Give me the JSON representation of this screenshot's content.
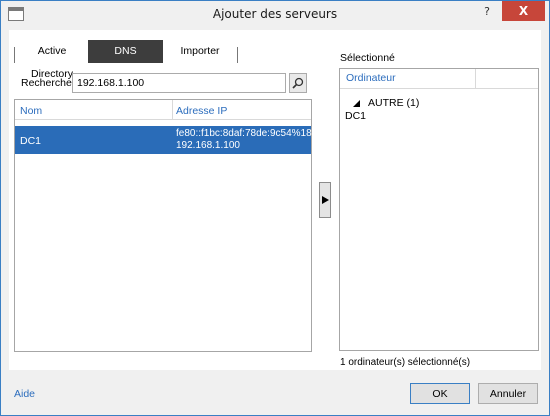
{
  "window": {
    "title": "Ajouter des serveurs",
    "help": "?",
    "close": "X"
  },
  "tabs": [
    {
      "label": "Active Directory",
      "active": false
    },
    {
      "label": "DNS",
      "active": true
    },
    {
      "label": "Importer",
      "active": false
    }
  ],
  "search": {
    "label": "Recherche :",
    "value": "192.168.1.100",
    "button_icon": "search-icon"
  },
  "results": {
    "columns": [
      "Nom",
      "Adresse IP"
    ],
    "rows": [
      {
        "name": "DC1",
        "ip_lines": [
          "fe80::f1bc:8daf:78de:9c54%18",
          "192.168.1.100"
        ],
        "selected": true
      }
    ]
  },
  "move_button": {
    "icon": "arrow-right-icon"
  },
  "selection": {
    "label": "Sélectionné",
    "column": "Ordinateur",
    "group": "AUTRE (1)",
    "items": [
      "DC1"
    ],
    "count_text": "1 ordinateur(s) sélectionné(s)"
  },
  "footer": {
    "help_link": "Aide",
    "ok": "OK",
    "cancel": "Annuler"
  },
  "colors": {
    "accent": "#2c6dbd",
    "selection": "#2a6cb8",
    "active_tab": "#3d3d3d",
    "close": "#c7463a"
  }
}
